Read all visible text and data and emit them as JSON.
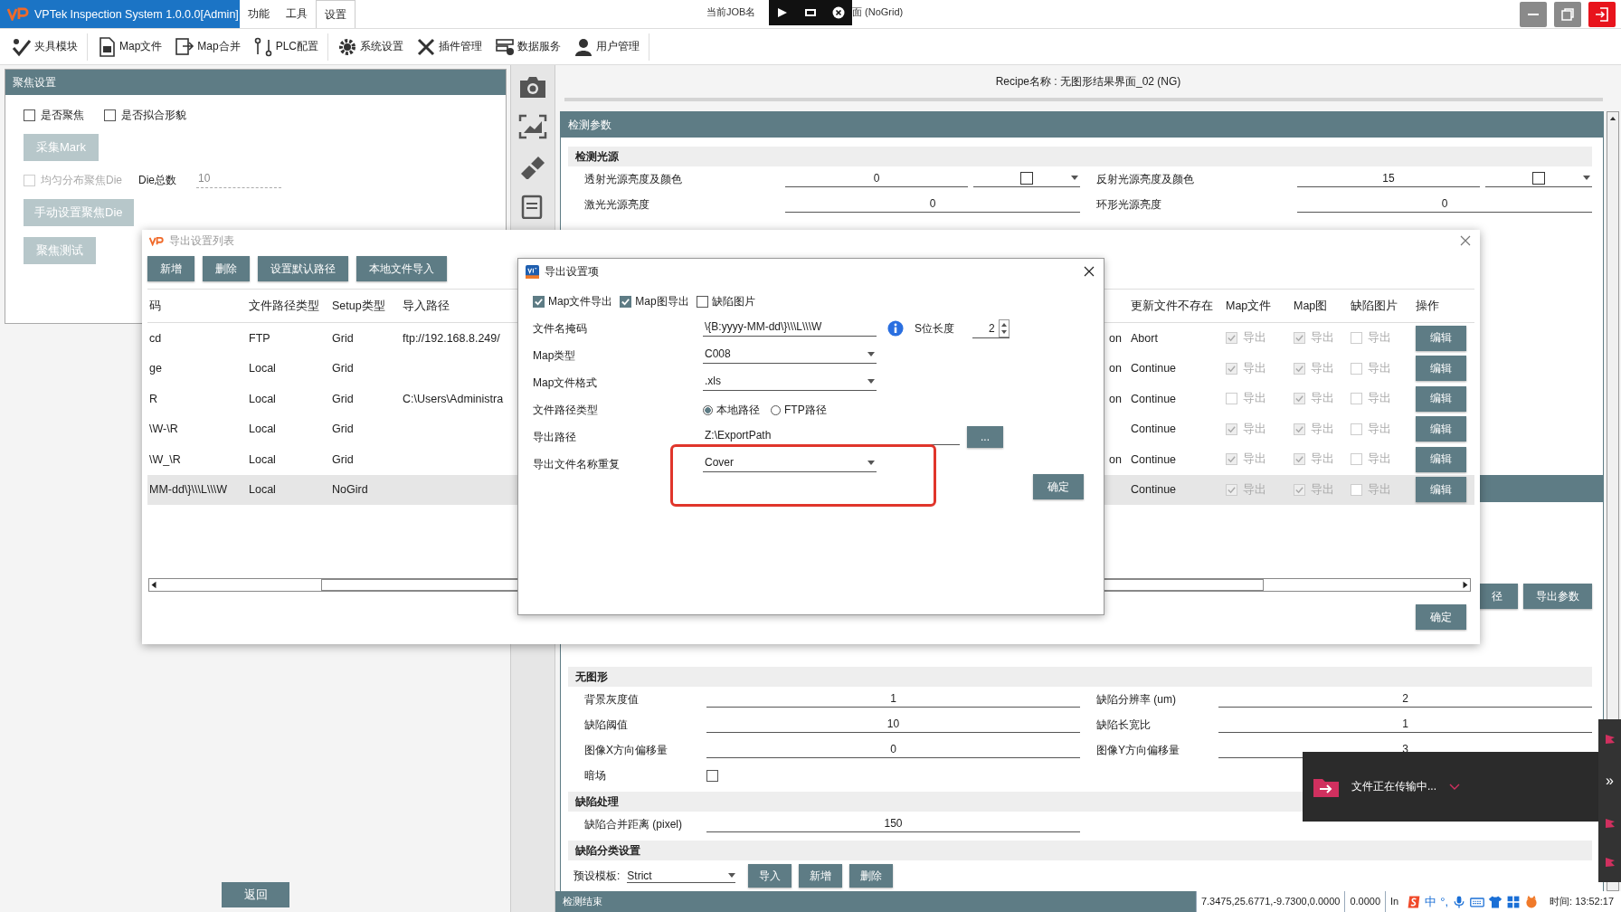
{
  "app": {
    "title": "VPTek Inspection System 1.0.0.0[Admin]",
    "menus": [
      {
        "label": "功能",
        "selected": false
      },
      {
        "label": "工具",
        "selected": false
      },
      {
        "label": "设置",
        "selected": true
      }
    ],
    "job_left": "当前JOB名",
    "job_right": "面 (NoGrid)"
  },
  "toolbar": [
    "夹具模块",
    "Map文件",
    "Map合并",
    "PLC配置",
    "系统设置",
    "插件管理",
    "数据服务",
    "用户管理"
  ],
  "focus_panel": {
    "title": "聚焦设置",
    "checkboxes": [
      {
        "label": "是否聚焦",
        "checked": false
      },
      {
        "label": "是否拟合形貌",
        "checked": false
      }
    ],
    "collect_button": "采集Mark",
    "uniform": {
      "label": "均匀分布聚焦Die",
      "checked": false
    },
    "die_total_label": "Die总数",
    "die_total": "10",
    "manual_button": "手动设置聚焦Die",
    "test_button": "聚焦测试"
  },
  "back_button": "返回",
  "recipe": "Recipe名称 : 无图形结果界面_02 (NG)",
  "params": {
    "title": "检测参数",
    "light_section": "检测光源",
    "light_rows": [
      {
        "left": {
          "kind": "color",
          "label": "透射光源亮度及颜色",
          "value": "0"
        },
        "right": {
          "kind": "color",
          "label": "反射光源亮度及颜色",
          "value": "15"
        }
      },
      {
        "left": {
          "kind": "number",
          "label": "激光光源亮度",
          "value": "0"
        },
        "right": {
          "kind": "number",
          "label": "环形光源亮度",
          "value": "0"
        }
      }
    ],
    "hidden_buttons": [
      "径",
      "导出参数"
    ],
    "sections": [
      {
        "title": "无图形",
        "rows": [
          {
            "left": {
              "kind": "number",
              "label": "背景灰度值",
              "value": "1"
            },
            "right": {
              "kind": "number",
              "label": "缺陷分辨率 (um)",
              "value": "2"
            }
          },
          {
            "left": {
              "kind": "number",
              "label": "缺陷阈值",
              "value": "10"
            },
            "right": {
              "kind": "number",
              "label": "缺陷长宽比",
              "value": "1"
            }
          },
          {
            "left": {
              "kind": "number",
              "label": "图像X方向偏移量",
              "value": "0"
            },
            "right": {
              "kind": "number",
              "label": "图像Y方向偏移量",
              "value": "3"
            }
          },
          {
            "left": {
              "kind": "checkbox",
              "label": "暗场",
              "checked": false
            }
          }
        ]
      },
      {
        "title": "缺陷处理",
        "rows": [
          {
            "left": {
              "kind": "number",
              "label": "缺陷合并距离 (pixel)",
              "value": "150"
            }
          }
        ]
      },
      {
        "title": "缺陷分类设置"
      }
    ],
    "template": {
      "label": "预设模板:",
      "value": "Strict",
      "buttons": [
        "导入",
        "新增",
        "删除"
      ]
    }
  },
  "status_bar": {
    "message": "检测结束",
    "coords": "7.3475,25.6771,-9.7300,0.0000",
    "value": "0.0000",
    "mode": "In",
    "ime": "中",
    "punct": "°,",
    "time": "时间: 13:52:17"
  },
  "export_list": {
    "title": "导出设置列表",
    "buttons": [
      "新增",
      "删除",
      "设置默认路径",
      "本地文件导入"
    ],
    "left_columns": [
      "码",
      "文件路径类型",
      "Setup类型",
      "导入路径"
    ],
    "right_columns": [
      "更新文件不存在",
      "Map文件",
      "Map图",
      "缺陷图片",
      "操作"
    ],
    "rows": [
      {
        "code": "cd",
        "path_type": "FTP",
        "setup_type": "Grid",
        "import_path": "ftp://192.168.8.249/",
        "column_5": "on",
        "if_missing": "Abort",
        "map_file": {
          "label": "导出",
          "checked": true
        },
        "map_image": {
          "label": "导出",
          "checked": true
        },
        "defect_image": {
          "label": "导出",
          "checked": false
        },
        "edit": "编辑",
        "selected": false
      },
      {
        "code": "ge",
        "path_type": "Local",
        "setup_type": "Grid",
        "column_5": "on",
        "if_missing": "Continue",
        "map_file": {
          "label": "导出",
          "checked": true
        },
        "map_image": {
          "label": "导出",
          "checked": true
        },
        "defect_image": {
          "label": "导出",
          "checked": false
        },
        "edit": "编辑",
        "selected": false
      },
      {
        "code": "R",
        "path_type": "Local",
        "setup_type": "Grid",
        "import_path": "C:\\Users\\Administra",
        "column_5": "on",
        "if_missing": "Continue",
        "map_file": {
          "label": "导出",
          "checked": false
        },
        "map_image": {
          "label": "导出",
          "checked": true
        },
        "defect_image": {
          "label": "导出",
          "checked": false
        },
        "edit": "编辑",
        "selected": false
      },
      {
        "code": "\\W-\\R",
        "path_type": "Local",
        "setup_type": "Grid",
        "if_missing": "Continue",
        "map_file": {
          "label": "导出",
          "checked": true
        },
        "map_image": {
          "label": "导出",
          "checked": true
        },
        "defect_image": {
          "label": "导出",
          "checked": false
        },
        "edit": "编辑",
        "selected": false
      },
      {
        "code": "\\W_\\R",
        "path_type": "Local",
        "setup_type": "Grid",
        "column_5": "on",
        "if_missing": "Continue",
        "map_file": {
          "label": "导出",
          "checked": true
        },
        "map_image": {
          "label": "导出",
          "checked": true
        },
        "defect_image": {
          "label": "导出",
          "checked": false
        },
        "edit": "编辑",
        "selected": false
      },
      {
        "code": "MM-dd\\}\\\\\\L\\\\\\W",
        "path_type": "Local",
        "setup_type": "NoGird",
        "if_missing": "Continue",
        "map_file": {
          "label": "导出",
          "checked": true
        },
        "map_image": {
          "label": "导出",
          "checked": true
        },
        "defect_image": {
          "label": "导出",
          "checked": false
        },
        "edit": "编辑",
        "selected": true
      }
    ],
    "ok": "确定"
  },
  "export_settings": {
    "title": "导出设置项",
    "exports": [
      {
        "label": "Map文件导出",
        "checked": true
      },
      {
        "label": "Map图导出",
        "checked": true
      },
      {
        "label": "缺陷图片",
        "checked": false
      }
    ],
    "mask_label": "文件名掩码",
    "mask": "\\{B:yyyy-MM-dd\\}\\\\\\L\\\\\\W",
    "s_len_label": "S位长度",
    "s_len": "2",
    "map_type_label": "Map类型",
    "map_type": "C008",
    "format_label": "Map文件格式",
    "format": ".xls",
    "path_type_label": "文件路径类型",
    "path_types": [
      {
        "label": "本地路径",
        "selected": true
      },
      {
        "label": "FTP路径",
        "selected": false
      }
    ],
    "export_path_label": "导出路径",
    "export_path": "Z:\\ExportPath",
    "browse": "...",
    "dup_label": "导出文件名称重复",
    "dup": "Cover",
    "ok": "确定"
  },
  "toast": {
    "text": "文件正在传输中...",
    "expand": "»"
  }
}
